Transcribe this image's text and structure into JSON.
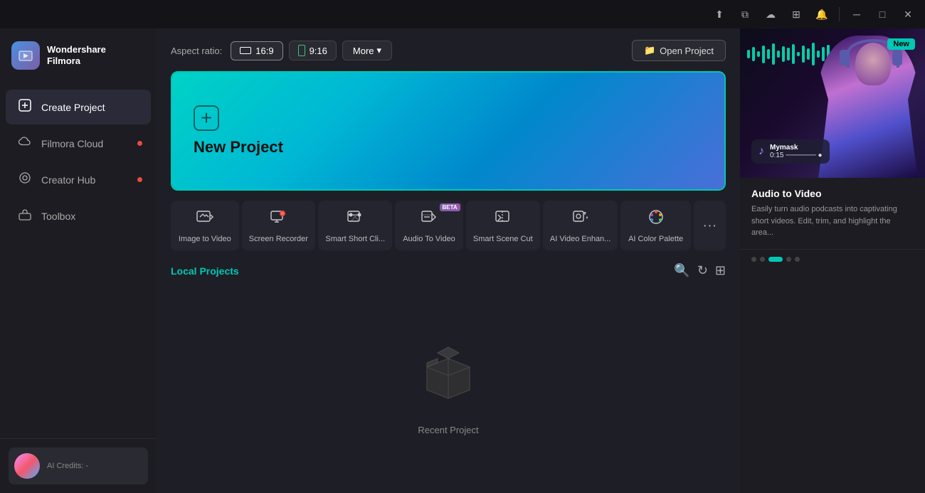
{
  "titlebar": {
    "icons": [
      "send-icon",
      "copy-icon",
      "cloud-icon",
      "grid-icon",
      "bell-icon",
      "minimize-icon",
      "maximize-icon",
      "close-icon"
    ]
  },
  "sidebar": {
    "logo": {
      "icon": "🎬",
      "name": "Wondershare",
      "product": "Filmora"
    },
    "nav_items": [
      {
        "id": "create-project",
        "label": "Create Project",
        "icon": "⊕",
        "active": true,
        "dot": false
      },
      {
        "id": "filmora-cloud",
        "label": "Filmora Cloud",
        "icon": "☁",
        "active": false,
        "dot": true
      },
      {
        "id": "creator-hub",
        "label": "Creator Hub",
        "icon": "◎",
        "active": false,
        "dot": true
      },
      {
        "id": "toolbox",
        "label": "Toolbox",
        "icon": "🧰",
        "active": false,
        "dot": false
      }
    ],
    "user": {
      "credits_label": "AI Credits: -"
    }
  },
  "topbar": {
    "aspect_ratio_label": "Aspect ratio:",
    "btn_16_9": "16:9",
    "btn_9_16": "9:16",
    "more_label": "More",
    "open_project_label": "Open Project"
  },
  "new_project": {
    "icon": "+",
    "title": "New Project"
  },
  "tools": [
    {
      "id": "image-to-video",
      "icon": "🎞",
      "label": "Image to Video",
      "beta": false
    },
    {
      "id": "screen-recorder",
      "icon": "📹",
      "label": "Screen Recorder",
      "beta": false
    },
    {
      "id": "smart-short-clip",
      "icon": "✂",
      "label": "Smart Short Cli...",
      "beta": false
    },
    {
      "id": "audio-to-video",
      "icon": "🎵",
      "label": "Audio To Video",
      "beta": true
    },
    {
      "id": "smart-scene-cut",
      "icon": "🎬",
      "label": "Smart Scene Cut",
      "beta": false
    },
    {
      "id": "ai-video-enhance",
      "icon": "✨",
      "label": "AI Video Enhan...",
      "beta": false
    },
    {
      "id": "ai-color-palette",
      "icon": "🎨",
      "label": "AI Color Palette",
      "beta": false
    }
  ],
  "local_projects": {
    "title": "Local Projects",
    "empty_label": "Recent Project"
  },
  "promo": {
    "new_badge": "New",
    "heading": "Audio to Video",
    "description": "Easily turn audio podcasts into captivating short videos. Edit, trim, and highlight the area...",
    "dots": [
      0,
      1,
      2,
      3,
      4
    ],
    "active_dot": 2
  },
  "audio_bars": [
    12,
    20,
    8,
    25,
    14,
    30,
    10,
    22,
    18,
    28,
    6,
    24
  ],
  "music": {
    "title": "Mymask",
    "subtitle": "0:15 ────── ●"
  }
}
